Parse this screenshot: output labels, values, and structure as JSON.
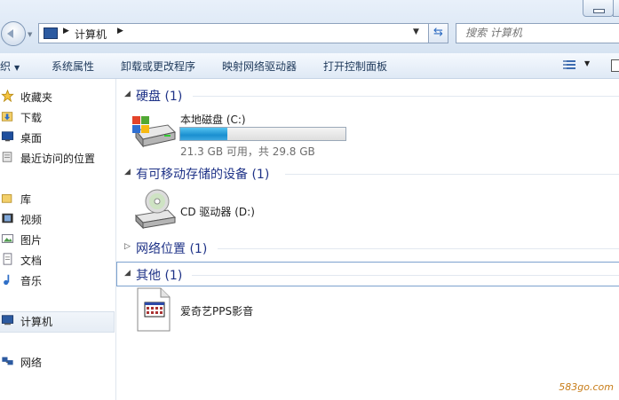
{
  "address_bar": {
    "location": "计算机",
    "search_placeholder": "搜索 计算机"
  },
  "command_bar": {
    "organize_label": "组织",
    "system_properties": "系统属性",
    "uninstall_program": "卸载或更改程序",
    "map_network_drive": "映射网络驱动器",
    "open_control_panel": "打开控制面板"
  },
  "nav_pane": {
    "favorites": "收藏夹",
    "downloads": "下载",
    "desktop": "桌面",
    "recent_places": "最近访问的位置",
    "libraries": "库",
    "videos": "视频",
    "pictures": "图片",
    "documents": "文档",
    "music": "音乐",
    "computer": "计算机",
    "network": "网络"
  },
  "content": {
    "hard_disks": {
      "title": "硬盘 (1)",
      "local_disk": {
        "name": "本地磁盘 (C:)",
        "space_text": "21.3 GB 可用，共 29.8 GB",
        "used_fraction": 0.285
      }
    },
    "removable": {
      "title": "有可移动存储的设备 (1)",
      "cd_drive": {
        "name": "CD 驱动器 (D:)"
      }
    },
    "network_locations": {
      "title": "网络位置 (1)"
    },
    "other": {
      "title": "其他 (1)",
      "pps": {
        "name": "爱奇艺PPS影音"
      }
    }
  },
  "watermark": "583go.com",
  "colors": {
    "group_title": "#1e3287",
    "command_text": "#1e395b",
    "drive_fill": "#1a8fd0"
  }
}
